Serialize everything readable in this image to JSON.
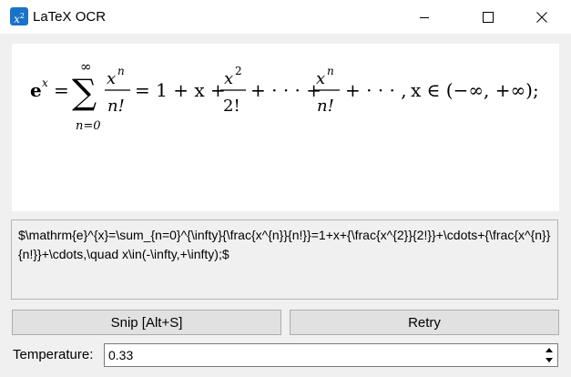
{
  "window": {
    "title": "LaTeX OCR",
    "icon": "x-squared-app-icon",
    "controls": [
      "minimize-icon",
      "maximize-icon",
      "close-icon"
    ]
  },
  "formula": {
    "lhs_base": "e",
    "lhs_exp": "x",
    "sum_top": "∞",
    "sum_bottom": "n=0",
    "frac1_num_base": "x",
    "frac1_num_exp": "n",
    "frac1_den": "n!",
    "mid": "= 1 + x +",
    "frac2_num_base": "x",
    "frac2_num_exp": "2",
    "frac2_den": "2!",
    "dots1": "+ · · · +",
    "frac3_num_base": "x",
    "frac3_num_exp": "n",
    "frac3_den": "n!",
    "tail": "+ · · · ,",
    "domain": "x ∈ (−∞, +∞);"
  },
  "latex_source": "$\\mathrm{e}^{x}=\\sum_{n=0}^{\\infty}{\\frac{x^{n}}{n!}}=1+x+{\\frac{x^{2}}{2!}}+\\cdots+{\\frac{x^{n}}{n!}}+\\cdots,\\quad x\\in(-\\infty,+\\infty);$",
  "buttons": {
    "snip": "Snip [Alt+S]",
    "retry": "Retry"
  },
  "temperature": {
    "label": "Temperature:",
    "value": "0.33"
  }
}
